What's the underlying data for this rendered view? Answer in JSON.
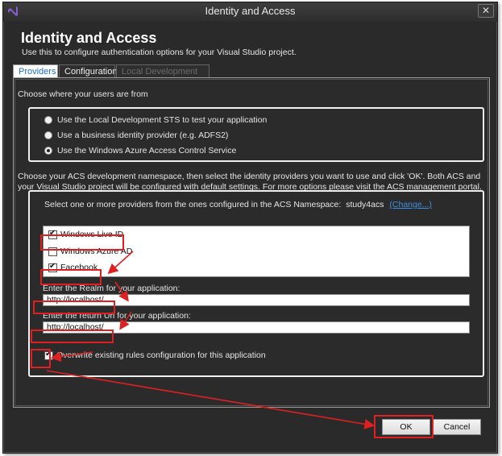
{
  "window": {
    "title": "Identity and Access"
  },
  "header": {
    "title": "Identity and Access",
    "subtitle": "Use this to configure authentication options for your Visual Studio project."
  },
  "tabs": [
    {
      "label": "Providers",
      "active": true
    },
    {
      "label": "Configuration",
      "active": false
    },
    {
      "label": "Local Development STS",
      "active": false
    }
  ],
  "users_section": {
    "label": "Choose where your users are from",
    "options": [
      {
        "label": "Use the Local Development STS to test your application",
        "selected": false
      },
      {
        "label": "Use a business identity provider (e.g. ADFS2)",
        "selected": false
      },
      {
        "label": "Use the Windows Azure Access Control Service",
        "selected": true
      }
    ]
  },
  "acs_section": {
    "description": "Choose your ACS development namespace, then select the identity providers you want to use and click 'OK'. Both ACS and your Visual Studio project will be configured with default settings. For more options please visit the ACS management portal.",
    "namespace_label": "Select one or more providers from the ones configured in the ACS Namespace:",
    "namespace_value": "study4acs",
    "change_link": "(Change...)",
    "providers": [
      {
        "label": "Windows Live ID",
        "checked": true
      },
      {
        "label": "Windows Azure AD",
        "checked": false
      },
      {
        "label": "Facebook",
        "checked": true
      }
    ],
    "realm_label": "Enter the Realm for your application:",
    "realm_value": "http://localhost/",
    "return_url_label": "Enter the return Url for your application:",
    "return_url_value": "http://localhost/",
    "overwrite_label": "Overwrite existing rules configuration for this application",
    "overwrite_checked": true
  },
  "buttons": {
    "ok": "OK",
    "cancel": "Cancel"
  },
  "icons": {
    "app": "visual-studio-icon",
    "close": "close-icon"
  },
  "colors": {
    "annotation": "#e02020",
    "link": "#3d8fe0",
    "active_tab_text": "#1e6fbf"
  }
}
